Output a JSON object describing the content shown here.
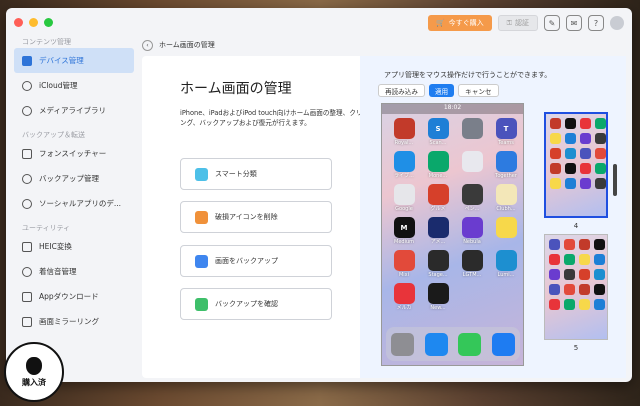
{
  "toolbar": {
    "buy_label": "今すぐ購入",
    "register_label": "認証"
  },
  "sidebar": {
    "sections": [
      {
        "title": "コンテンツ管理",
        "items": [
          {
            "label": "デバイス管理",
            "icon": "device-icon",
            "active": true
          },
          {
            "label": "iCloud管理",
            "icon": "cloud-icon"
          },
          {
            "label": "メディアライブラリ",
            "icon": "music-icon"
          }
        ]
      },
      {
        "title": "バックアップ＆転送",
        "items": [
          {
            "label": "フォンスイッチャー",
            "icon": "phone-switch-icon"
          },
          {
            "label": "バックアップ管理",
            "icon": "history-icon"
          },
          {
            "label": "ソーシャルアプリのデ...",
            "icon": "chat-icon"
          }
        ]
      },
      {
        "title": "ユーティリティ",
        "items": [
          {
            "label": "HEIC変換",
            "icon": "heic-icon"
          },
          {
            "label": "着信音管理",
            "icon": "bell-icon"
          },
          {
            "label": "Appダウンロード",
            "icon": "app-download-icon"
          },
          {
            "label": "画面ミラーリング",
            "icon": "mirror-icon"
          }
        ]
      }
    ]
  },
  "breadcrumb": {
    "label": "ホーム画面の管理"
  },
  "left_panel": {
    "title": "ホーム画面の管理",
    "description": "iPhone、iPadおよびiPod touch向けホーム画面の整理、クリーニング、バックアップおよび復元が行えます。",
    "actions": [
      {
        "label": "スマート分類",
        "color": "#4dc0e8"
      },
      {
        "label": "破損アイコンを削除",
        "color": "#f0913a"
      },
      {
        "label": "画面をバックアップ",
        "color": "#3f86ef"
      },
      {
        "label": "バックアップを確認",
        "color": "#3ebf6a"
      }
    ]
  },
  "right_panel": {
    "title": "アプリ管理をマウス操作だけで行うことができます。",
    "buttons": [
      {
        "label": "再読み込み",
        "style": "plain"
      },
      {
        "label": "適用",
        "style": "blue"
      },
      {
        "label": "キャンセ",
        "style": "plain"
      }
    ],
    "phone": {
      "time": "18:02",
      "apps": [
        {
          "label": "Royal...",
          "color": "#c23a2a",
          "glyph": ""
        },
        {
          "label": "Scan...",
          "color": "#1e7fd6",
          "glyph": "S"
        },
        {
          "label": "",
          "color": "#7a7f8a",
          "glyph": ""
        },
        {
          "label": "Teams",
          "color": "#4b53bc",
          "glyph": "T"
        },
        {
          "label": "ライブ...",
          "color": "#1f8fe6",
          "glyph": ""
        },
        {
          "label": "Mone...",
          "color": "#0aa86b",
          "glyph": ""
        },
        {
          "label": "",
          "color": "#e8e8ee",
          "glyph": ""
        },
        {
          "label": "Together",
          "color": "#2d7be0",
          "glyph": ""
        },
        {
          "label": "Google",
          "color": "#e6e6ea",
          "glyph": ""
        },
        {
          "label": "グルメ",
          "color": "#d6402a",
          "glyph": ""
        },
        {
          "label": "ペン...",
          "color": "#3a3a3a",
          "glyph": ""
        },
        {
          "label": "Clubh...",
          "color": "#f3e7b8",
          "glyph": ""
        },
        {
          "label": "Medium",
          "color": "#111111",
          "glyph": "M"
        },
        {
          "label": "アメ...",
          "color": "#1a2b6d",
          "glyph": ""
        },
        {
          "label": "Nebula",
          "color": "#6a3ccf",
          "glyph": ""
        },
        {
          "label": "",
          "color": "#f7d84a",
          "glyph": ""
        },
        {
          "label": "Mixi",
          "color": "#e24a3a",
          "glyph": ""
        },
        {
          "label": "Stage...",
          "color": "#2a2a2a",
          "glyph": ""
        },
        {
          "label": "LGTM...",
          "color": "#2b2b2b",
          "glyph": ""
        },
        {
          "label": "Lumi...",
          "color": "#1d8fd0",
          "glyph": ""
        },
        {
          "label": "メルカ",
          "color": "#e8343a",
          "glyph": ""
        },
        {
          "label": "New...",
          "color": "#1a1a1a",
          "glyph": ""
        }
      ],
      "dock": [
        {
          "icon": "settings-icon",
          "color": "#8e8e93"
        },
        {
          "icon": "safari-icon",
          "color": "#1e88f0"
        },
        {
          "icon": "messages-icon",
          "color": "#34c759"
        },
        {
          "icon": "mail-icon",
          "color": "#1e7cf2"
        }
      ]
    },
    "pages": [
      {
        "number": "4",
        "selected": true
      },
      {
        "number": "5",
        "selected": false
      }
    ]
  },
  "watermark": {
    "text": "購入済"
  }
}
